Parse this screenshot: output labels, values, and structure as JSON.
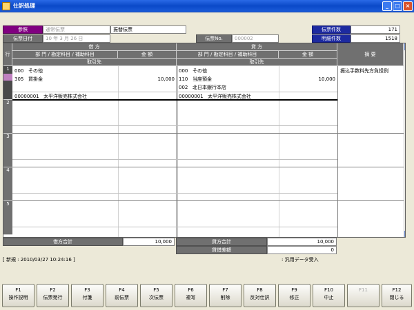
{
  "window": {
    "title": "仕訳処理"
  },
  "header": {
    "reference_label": "参照",
    "voucher_type_value": "通常伝票",
    "voucher_kind_value": "振替伝票",
    "date_label": "伝票日付",
    "date_value": "10 年 3 月 26 日",
    "voucher_no_label": "伝票No.",
    "voucher_no_value": "000002",
    "voucher_count_label": "伝票件数",
    "voucher_count_value": "171",
    "detail_count_label": "明細件数",
    "detail_count_value": "1518"
  },
  "grid": {
    "row_header": "行",
    "debit_header": "借 方",
    "credit_header": "貸 方",
    "dept_account_header": "部 門 / 勘定科目 / 補助科目",
    "amount_header": "金 額",
    "partner_header": "取引先",
    "memo_header": "摘 要",
    "row_numbers": [
      "1",
      "2",
      "3",
      "4",
      "5"
    ],
    "row1": {
      "debit_dept_code": "000",
      "debit_dept_name": "その他",
      "debit_account_code": "305",
      "debit_account_name": "買掛金",
      "debit_amount": "10,000",
      "debit_partner_code": "00000001",
      "debit_partner_name": "太平洋販売株式会社",
      "credit_dept_code": "000",
      "credit_dept_name": "その他",
      "credit_account_code": "110",
      "credit_account_name": "当座預金",
      "credit_amount": "10,000",
      "credit_sub_code": "002",
      "credit_sub_name": "北日本銀行本店",
      "credit_partner_code": "00000001",
      "credit_partner_name": "太平洋販売株式会社",
      "memo": "振込手数料先方負担例"
    }
  },
  "totals": {
    "debit_total_label": "借方合計",
    "debit_total_value": "10,000",
    "credit_total_label": "貸方合計",
    "credit_total_value": "10,000",
    "diff_label": "貸借差額",
    "diff_value": "0"
  },
  "status": {
    "mode_text": "[ 新規 : 2010/03/27 10:24:16 ]",
    "import_text": ": 汎用データ受入"
  },
  "function_keys": [
    {
      "key": "F1",
      "label": "操作説明"
    },
    {
      "key": "F2",
      "label": "伝票発行"
    },
    {
      "key": "F3",
      "label": "付箋"
    },
    {
      "key": "F4",
      "label": "前伝票"
    },
    {
      "key": "F5",
      "label": "次伝票"
    },
    {
      "key": "F6",
      "label": "複写"
    },
    {
      "key": "F7",
      "label": "削除"
    },
    {
      "key": "F8",
      "label": "反対仕訳"
    },
    {
      "key": "F9",
      "label": "修正"
    },
    {
      "key": "F10",
      "label": "中止"
    },
    {
      "key": "F11",
      "label": ""
    },
    {
      "key": "F12",
      "label": "閉じる"
    }
  ]
}
